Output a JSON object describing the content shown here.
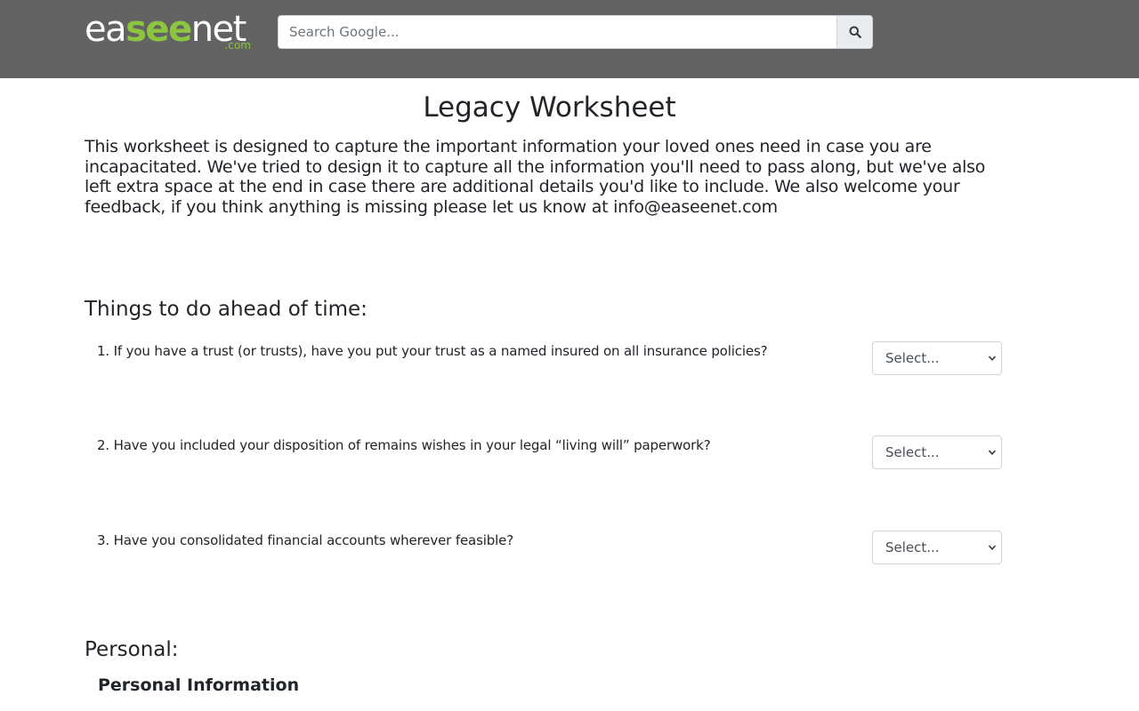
{
  "header": {
    "logo": {
      "part1": "ea",
      "part2": "see",
      "part3": "net",
      "suffix": ".com"
    },
    "search": {
      "placeholder": "Search Google..."
    },
    "search_icon": "search-icon"
  },
  "main": {
    "title": "Legacy Worksheet",
    "intro": "This worksheet is designed to capture the important information your loved ones need in case you are incapacitated. We've tried to design it to capture all the information you'll need to pass along, but we've also left extra space at the end in case there are additional details you'd like to include. We also welcome your feedback, if you think anything is missing please let us know at info@easeenet.com",
    "sections": [
      {
        "heading": "Things to do ahead of time:",
        "questions": [
          {
            "text": "1. If you have a trust (or trusts), have you put your trust as a named insured on all insurance policies?",
            "select_value": "Select..."
          },
          {
            "text": "2. Have you included your disposition of remains wishes in your legal “living will” paperwork?",
            "select_value": "Select..."
          },
          {
            "text": "3. Have you consolidated financial accounts wherever feasible?",
            "select_value": "Select..."
          }
        ]
      },
      {
        "heading": "Personal:",
        "subheading": "Personal Information"
      }
    ]
  },
  "colors": {
    "header_bg": "#636363",
    "logo_green": "#8cc63f",
    "text": "#212529"
  }
}
